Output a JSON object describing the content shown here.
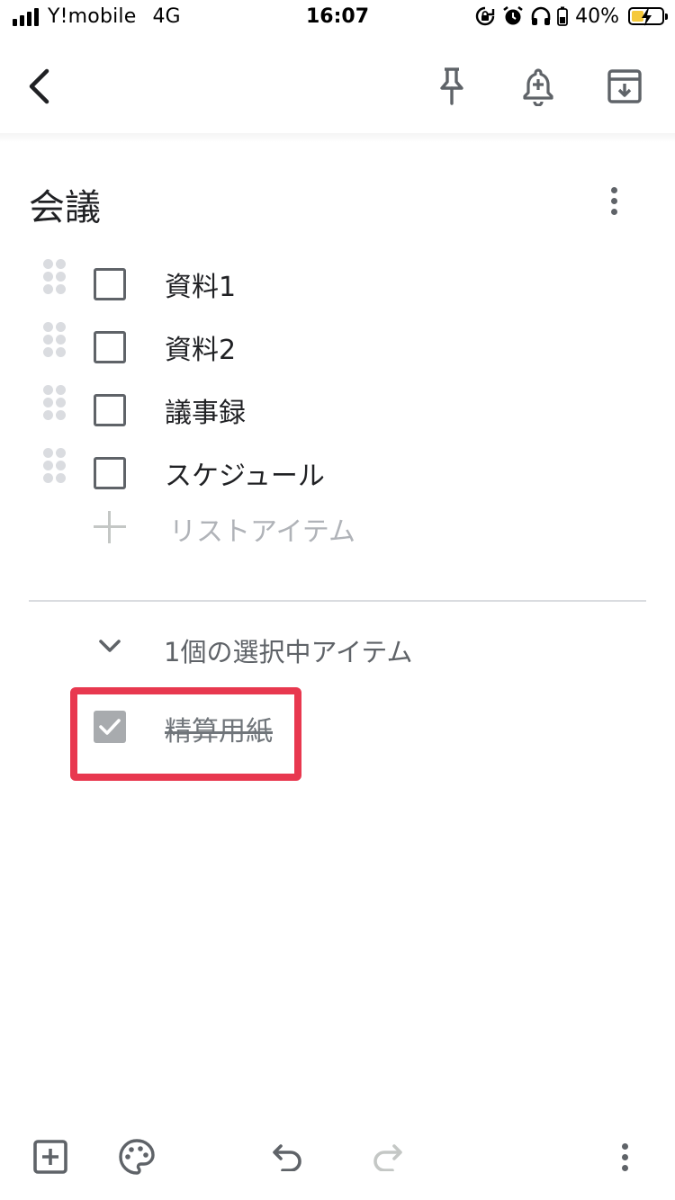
{
  "status_bar": {
    "carrier": "Y!mobile",
    "network": "4G",
    "time": "16:07",
    "battery_percent": "40%",
    "battery_level": 0.4,
    "battery_color": "#f5c93b"
  },
  "toolbar": {
    "back_icon": "chevron-left-icon",
    "pin_icon": "pin-icon",
    "reminder_icon": "bell-plus-icon",
    "archive_icon": "archive-icon"
  },
  "note": {
    "title": "会議",
    "items": [
      {
        "label": "資料1",
        "checked": false
      },
      {
        "label": "資料2",
        "checked": false
      },
      {
        "label": "議事録",
        "checked": false
      },
      {
        "label": "スケジュール",
        "checked": false
      }
    ],
    "add_item_placeholder": "リストアイテム",
    "checked_section_label": "1個の選択中アイテム",
    "checked_items": [
      {
        "label": "精算用紙",
        "checked": true
      }
    ]
  },
  "annotation": {
    "highlight_color": "#e8384f"
  },
  "bottom_bar": {
    "icons": [
      "add-box-icon",
      "palette-icon",
      "undo-icon",
      "redo-icon",
      "more-vert-icon"
    ]
  }
}
